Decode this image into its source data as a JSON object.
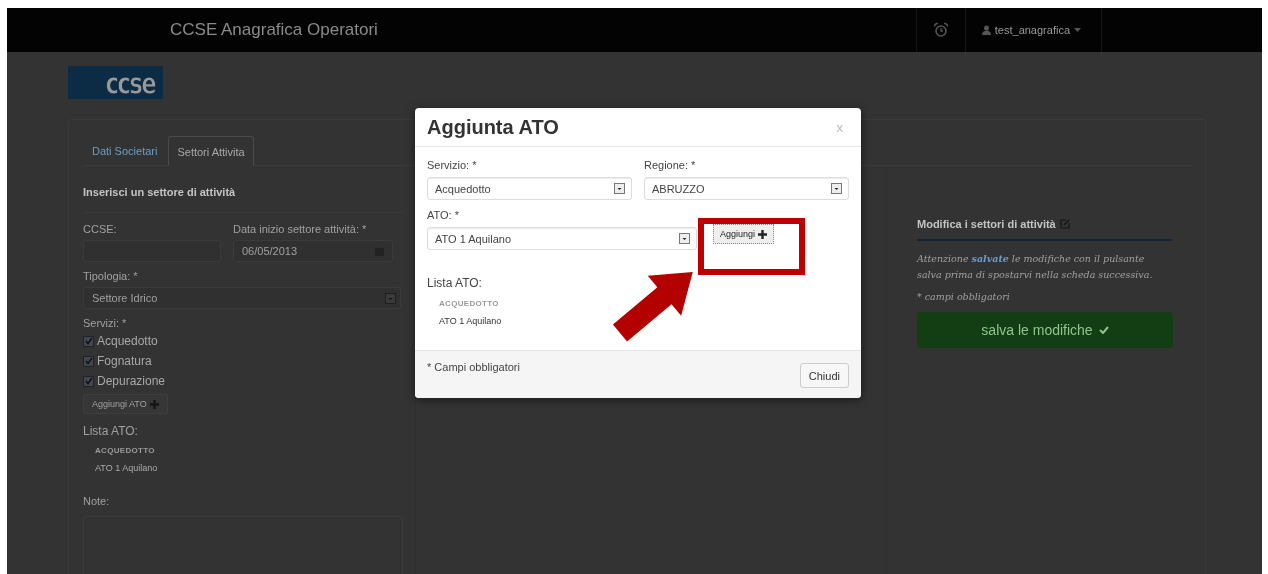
{
  "navbar": {
    "title": "CCSE Anagrafica Operatori",
    "user": "test_anagrafica"
  },
  "logo": "ccse",
  "tabs": [
    {
      "label": "Dati Societari",
      "selected": false
    },
    {
      "label": "Settori Attivita",
      "selected": true
    }
  ],
  "form": {
    "heading": "Inserisci un settore di attività",
    "ccse_label": "CCSE:",
    "date_label": "Data inizio settore attività: *",
    "date_value": "06/05/2013",
    "tipologia_label": "Tipologia: *",
    "tipologia_value": "Settore Idrico",
    "servizi_label": "Servizi: *",
    "servizi": [
      {
        "label": "Acquedotto",
        "checked": true
      },
      {
        "label": "Fognatura",
        "checked": true
      },
      {
        "label": "Depurazione",
        "checked": true
      }
    ],
    "add_button": "Aggiungi ATO",
    "lista_label": "Lista ATO:",
    "lista": [
      {
        "group": "ACQUEDOTTO",
        "items": [
          "ATO 1 Aquilano"
        ]
      }
    ],
    "note_label": "Note:"
  },
  "side": {
    "heading": "Modifica i settori di attività",
    "notice": "Attenzione **salvate** le modifiche con il pulsante salva prima di spostarvi nella scheda successiva.",
    "required_note": "* campi obbligatori",
    "save_button": "salva le modifiche"
  },
  "modal": {
    "title": "Aggiunta ATO",
    "close": "x",
    "fields": [
      {
        "label": "Servizio: *",
        "value": "Acquedotto"
      },
      {
        "label": "Regione: *",
        "value": "ABRUZZO"
      }
    ],
    "ato_label": "ATO: *",
    "ato_value": "ATO 1 Aquilano",
    "add_button": "Aggiungi",
    "lista_label": "Lista ATO:",
    "lista": [
      {
        "group": "ACQUEDOTTO",
        "items": [
          "ATO 1 Aquilano"
        ]
      }
    ],
    "footer_note": "* Campi obbligatori",
    "close_button": "Chiudi"
  }
}
